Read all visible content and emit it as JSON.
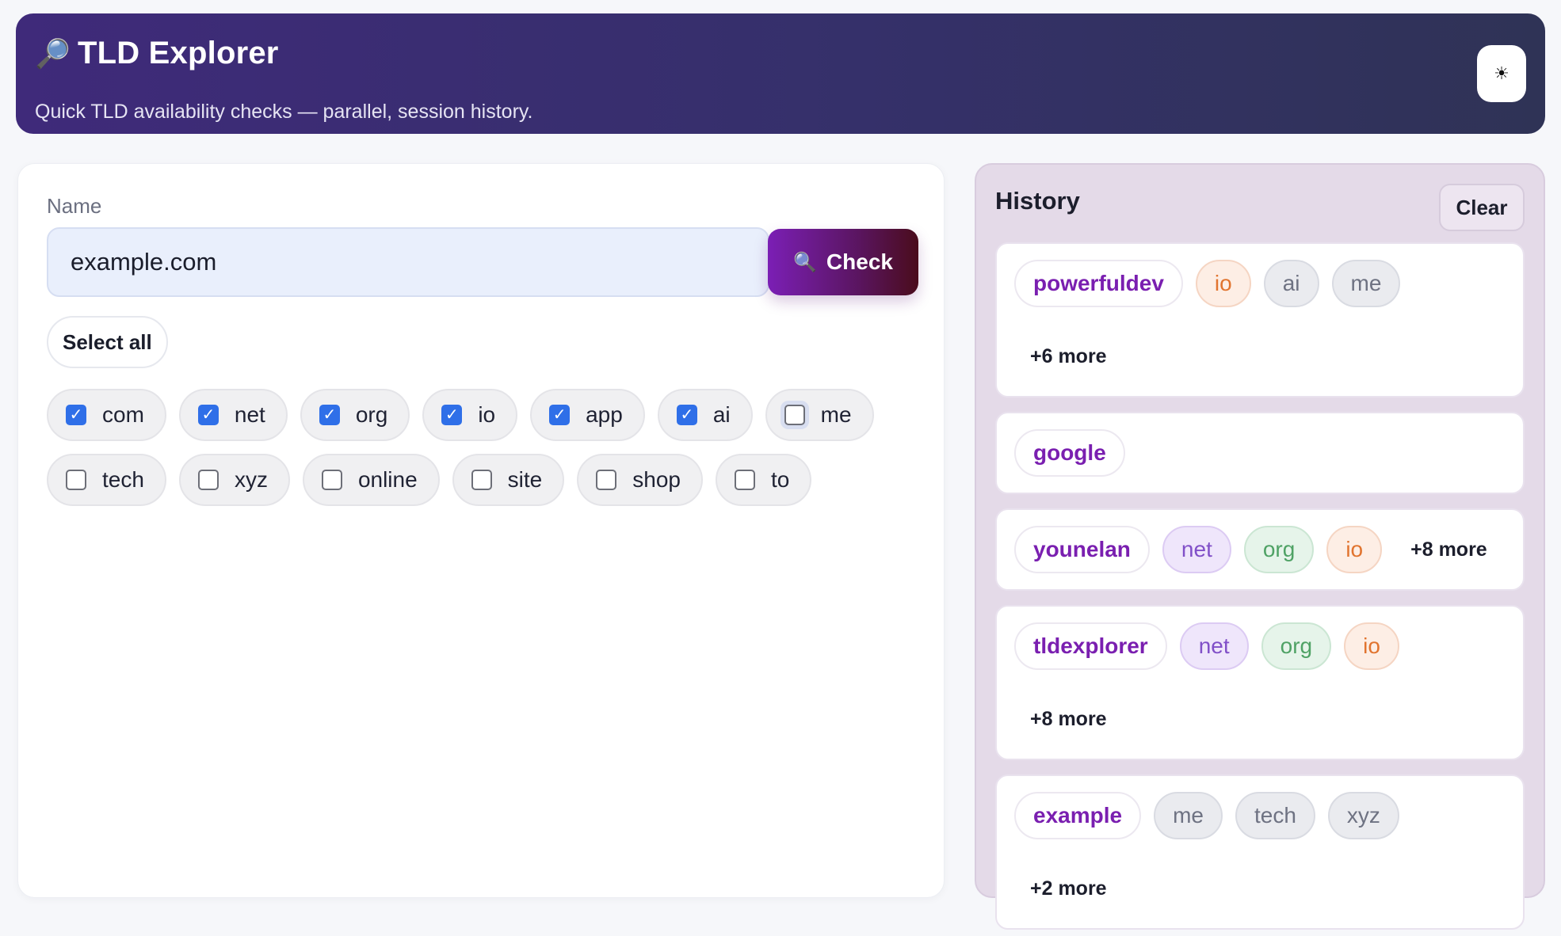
{
  "header": {
    "icon": "🔎",
    "title": "TLD Explorer",
    "subtitle": "Quick TLD availability checks — parallel, session history.",
    "theme_toggle": "☀"
  },
  "form": {
    "name_label": "Name",
    "name_value": "example.com",
    "check_icon": "🔍",
    "check_label": "Check",
    "select_all_label": "Select all",
    "tlds": [
      {
        "label": "com",
        "checked": true
      },
      {
        "label": "net",
        "checked": true
      },
      {
        "label": "org",
        "checked": true
      },
      {
        "label": "io",
        "checked": true
      },
      {
        "label": "app",
        "checked": true
      },
      {
        "label": "ai",
        "checked": true
      },
      {
        "label": "me",
        "checked": false
      },
      {
        "label": "tech",
        "checked": false
      },
      {
        "label": "xyz",
        "checked": false
      },
      {
        "label": "online",
        "checked": false
      },
      {
        "label": "site",
        "checked": false
      },
      {
        "label": "shop",
        "checked": false
      },
      {
        "label": "to",
        "checked": false
      }
    ]
  },
  "history": {
    "title": "History",
    "clear_label": "Clear",
    "entries": [
      {
        "name": "powerfuldev",
        "tlds": [
          "io",
          "ai",
          "me"
        ],
        "more": "+6 more"
      },
      {
        "name": "google",
        "tlds": [],
        "more": ""
      },
      {
        "name": "younelan",
        "tlds": [
          "net",
          "org",
          "io"
        ],
        "more": "+8 more"
      },
      {
        "name": "tldexplorer",
        "tlds": [
          "net",
          "org",
          "io"
        ],
        "more": "+8 more"
      },
      {
        "name": "example",
        "tlds": [
          "me",
          "tech",
          "xyz"
        ],
        "more": "+2 more"
      }
    ]
  }
}
